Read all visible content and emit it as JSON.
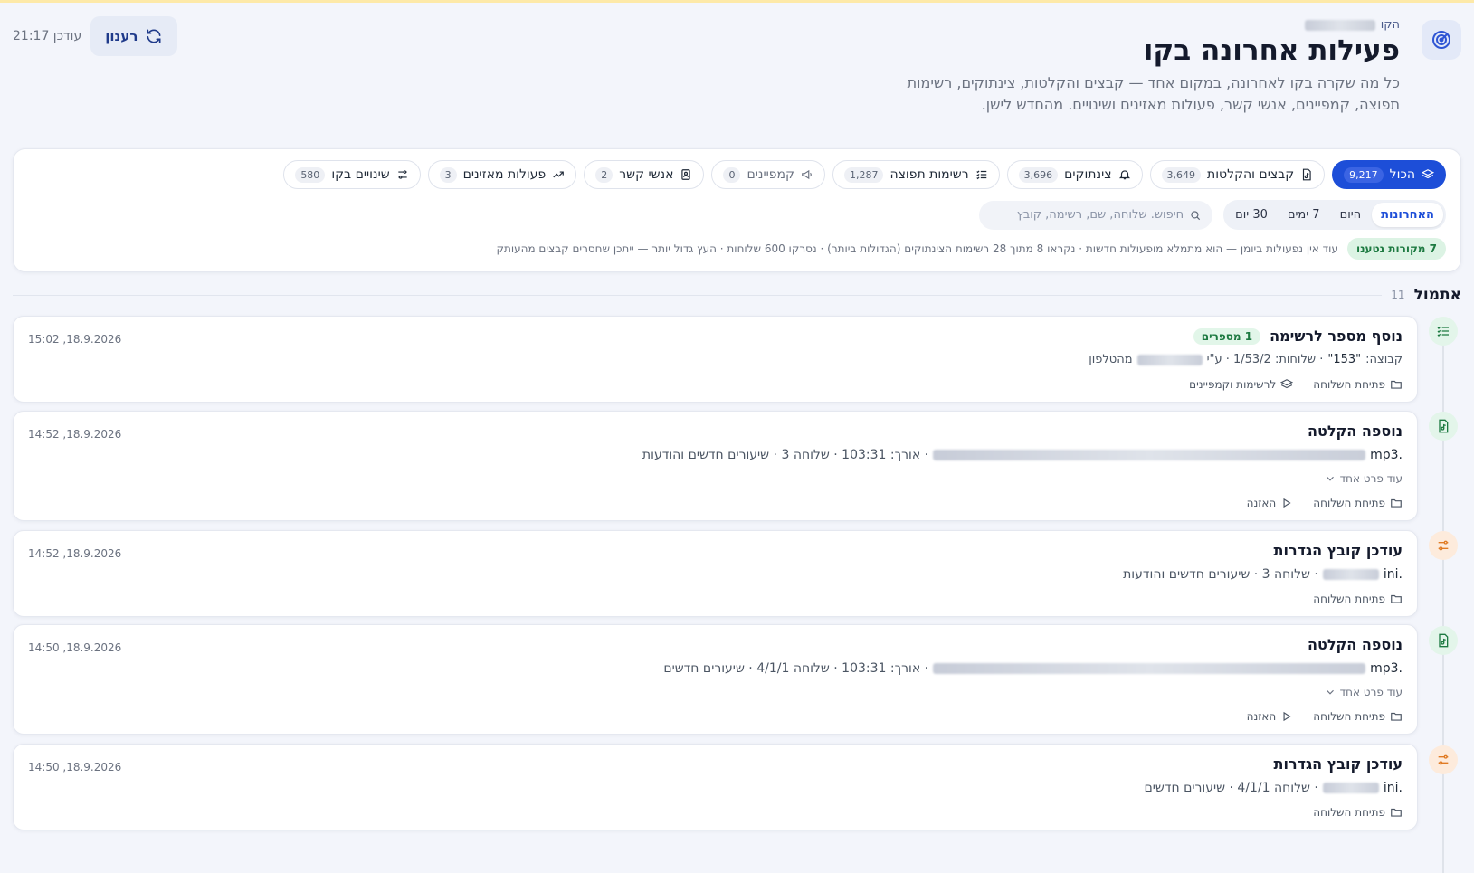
{
  "header": {
    "kicker": "הקו",
    "title": "פעילות אחרונה בקו",
    "subtitle": "כל מה שקרה בקו לאחרונה, במקום אחד — קבצים והקלטות, צינתוקים, רשימות תפוצה, קמפיינים, אנשי קשר, פעולות מאזינים ושינויים. מהחדש לישן.",
    "updated_label": "עודכן 21:17",
    "refresh_label": "רענון"
  },
  "filters": {
    "chips": [
      {
        "label": "הכול",
        "count": "9,217",
        "icon": "layers-icon",
        "active": true
      },
      {
        "label": "קבצים והקלטות",
        "count": "3,649",
        "icon": "audio-file-icon"
      },
      {
        "label": "צינתוקים",
        "count": "3,696",
        "icon": "bell-icon"
      },
      {
        "label": "רשימות תפוצה",
        "count": "1,287",
        "icon": "list-check-icon"
      },
      {
        "label": "קמפיינים",
        "count": "0",
        "icon": "megaphone-icon",
        "muted": true
      },
      {
        "label": "אנשי קשר",
        "count": "2",
        "icon": "contact-book-icon"
      },
      {
        "label": "פעולות מאזינים",
        "count": "3",
        "icon": "trend-up-icon"
      },
      {
        "label": "שינויים בקו",
        "count": "580",
        "icon": "sliders-icon"
      }
    ],
    "periods": [
      "האחרונות",
      "היום",
      "7 ימים",
      "30 יום"
    ],
    "search_placeholder": "חיפוש. שלוחה, שם, רשימה, קובץ",
    "sources_badge": "7 מקורות נטענו",
    "notice": "עוד אין נפעולות ביומן — הוא מתמלא מופעולות חדשות · נקראו 8 מתוך 28 רשימות הצינתוקים (הגדולות ביותר) · נסרקו 600 שלוחות · העץ גדול יותר — ייתכן שחסרים קבצים מהעותק"
  },
  "day": {
    "name": "אתמול",
    "count": "11"
  },
  "events": [
    {
      "title": "נוסף מספר לרשימה",
      "tag": "1 מספרים",
      "time": "15:02 ,18.9.2026",
      "meta_parts": [
        "קבוצה: ",
        "\"153\"",
        " · שלוחות: 1/53/2 · ע\"י",
        "מהטלפון"
      ],
      "actions": [
        "פתיחת השלוחה",
        "לרשימות וקמפיינים"
      ]
    },
    {
      "title": "נוספה הקלטה",
      "time": "14:52 ,18.9.2026",
      "file_ext": ".mp3",
      "meta": "· אורך: 103:31 · שלוחה 3 · שיעורים חדשים והודעות",
      "more": "עוד פרט אחד",
      "actions": [
        "פתיחת השלוחה",
        "האזנה"
      ]
    },
    {
      "title": "עודכן קובץ הגדרות",
      "time": "14:52 ,18.9.2026",
      "file_ext": ".ini",
      "meta": "· שלוחה 3 · שיעורים חדשים והודעות",
      "actions": [
        "פתיחת השלוחה"
      ]
    },
    {
      "title": "נוספה הקלטה",
      "time": "14:50 ,18.9.2026",
      "file_ext": ".mp3",
      "meta": "· אורך: 103:31 · שלוחה 4/1/1 · שיעורים חדשים",
      "more": "עוד פרט אחד",
      "actions": [
        "פתיחת השלוחה",
        "האזנה"
      ]
    },
    {
      "title": "עודכן קובץ הגדרות",
      "time": "14:50 ,18.9.2026",
      "file_ext": ".ini",
      "meta": "· שלוחה 4/1/1 · שיעורים חדשים",
      "actions": [
        "פתיחת השלוחה"
      ]
    }
  ],
  "colors": {
    "accent": "#1d4ed8",
    "success": "#1d7a41",
    "warning": "#e07b24",
    "background": "#f3f5fb"
  }
}
